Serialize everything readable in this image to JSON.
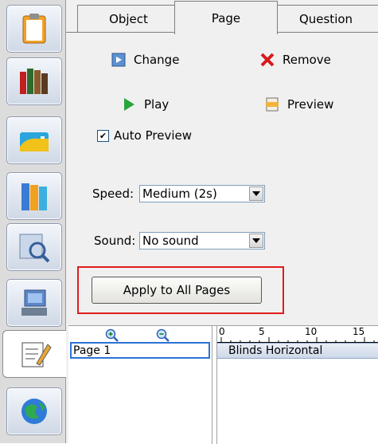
{
  "sidebar": {
    "items": [
      {
        "name": "clipboard-icon"
      },
      {
        "name": "books-icon"
      },
      {
        "name": "folder-icon"
      },
      {
        "name": "binders-icon"
      },
      {
        "name": "magnifier-icon"
      },
      {
        "name": "computer-icon"
      },
      {
        "name": "edit-icon"
      },
      {
        "name": "globe-icon"
      }
    ]
  },
  "tabs": [
    "Object",
    "Page",
    "Question"
  ],
  "actions": {
    "change": "Change",
    "remove": "Remove",
    "play": "Play",
    "preview": "Preview",
    "auto_preview": "Auto Preview",
    "auto_preview_checked": true
  },
  "speed": {
    "label": "Speed:",
    "value": "Medium (2s)"
  },
  "sound": {
    "label": "Sound:",
    "value": "No sound"
  },
  "apply_button": "Apply to All Pages",
  "page_list": {
    "items": [
      "Page 1"
    ]
  },
  "timeline": {
    "ticks": [
      "0",
      "5",
      "10",
      "15"
    ],
    "track_label": "Blinds Horizontal"
  },
  "colors": {
    "highlight": "#e21b1b",
    "selection": "#2b73d6"
  }
}
